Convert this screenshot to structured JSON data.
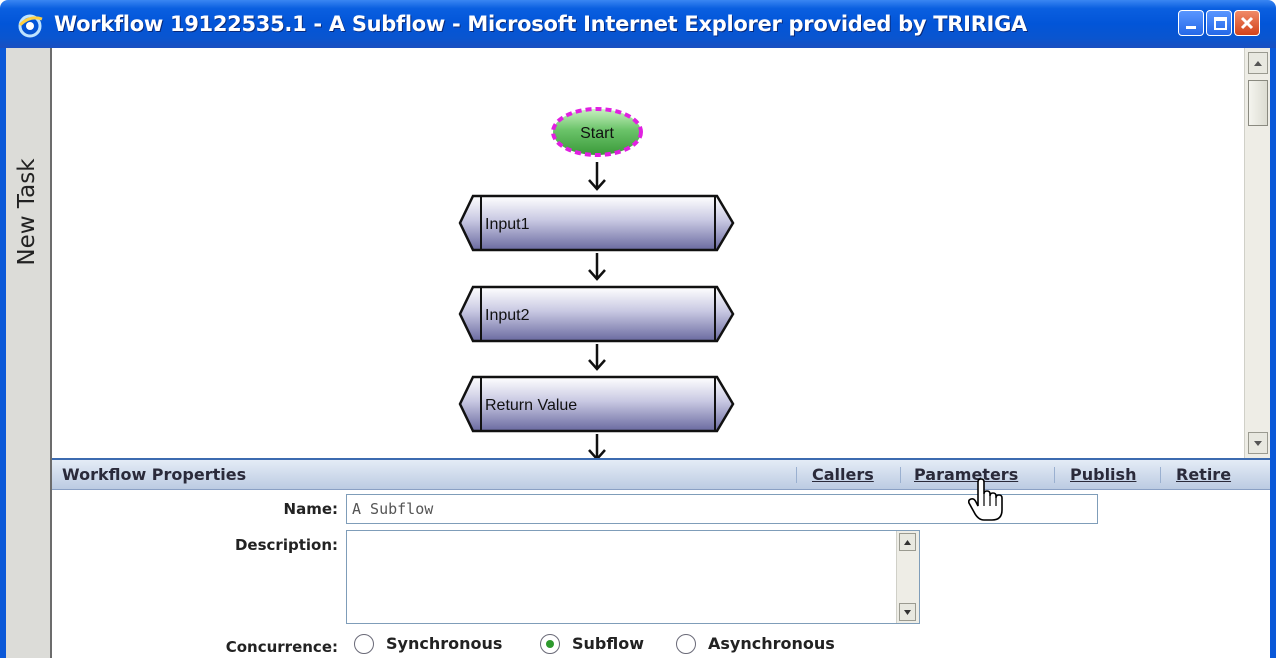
{
  "window": {
    "title": "Workflow 19122535.1 - A Subflow - Microsoft Internet Explorer provided by TRIRIGA"
  },
  "side_tab": {
    "label": "New Task"
  },
  "diagram": {
    "start_label": "Start",
    "steps": [
      "Input1",
      "Input2",
      "Return Value"
    ]
  },
  "properties": {
    "title": "Workflow Properties",
    "links": [
      "Callers",
      "Parameters",
      "Publish",
      "Retire"
    ],
    "name_label": "Name:",
    "name_value": "A Subflow",
    "description_label": "Description:",
    "description_value": "",
    "concurrence_label": "Concurrence:",
    "concurrence_options": [
      "Synchronous",
      "Subflow",
      "Asynchronous"
    ],
    "concurrence_selected": "Subflow"
  },
  "colors": {
    "title_bar": "#0255d8",
    "start_fill": "#5cb85c",
    "start_border": "#e020e0",
    "step_fill": "#9a9ac8"
  }
}
